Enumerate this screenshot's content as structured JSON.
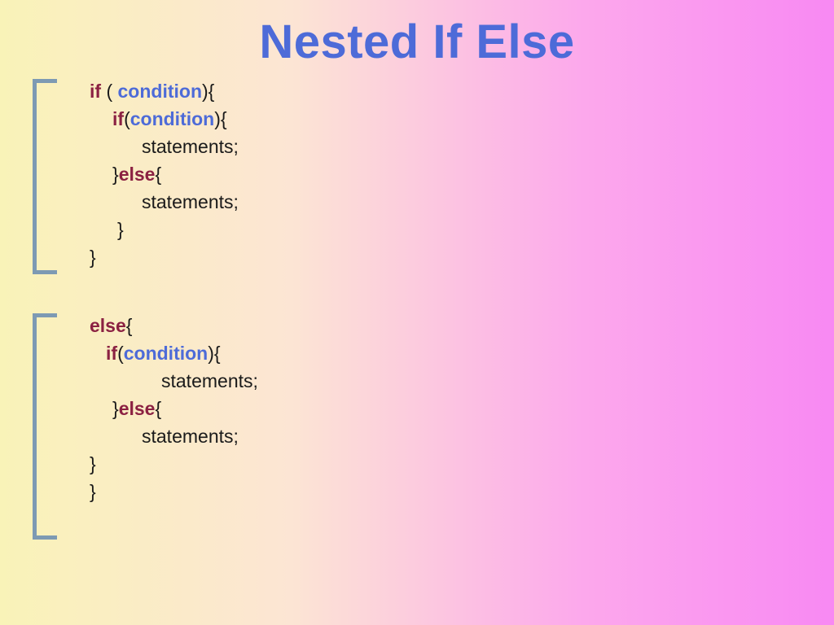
{
  "title": "Nested If Else",
  "block1": {
    "line1_if": "if",
    "line1_paren_open": " ( ",
    "line1_cond": "condition",
    "line1_close": "){",
    "line2_if": "if",
    "line2_paren_open": "(",
    "line2_cond": "condition",
    "line2_close": "){",
    "line3": "statements;",
    "line4_close": "}",
    "line4_else": "else",
    "line4_open": "{",
    "line5": "statements;",
    "line6": "}",
    "line7": "}"
  },
  "block2": {
    "line1_else": "else",
    "line1_open": "{",
    "line2_if": "if",
    "line2_paren_open": "(",
    "line2_cond": "condition",
    "line2_close": "){",
    "line3": "statements;",
    "line4_close": "}",
    "line4_else": "else",
    "line4_open": "{",
    "line5": "statements;",
    "line6": "}",
    "line7": "}"
  }
}
